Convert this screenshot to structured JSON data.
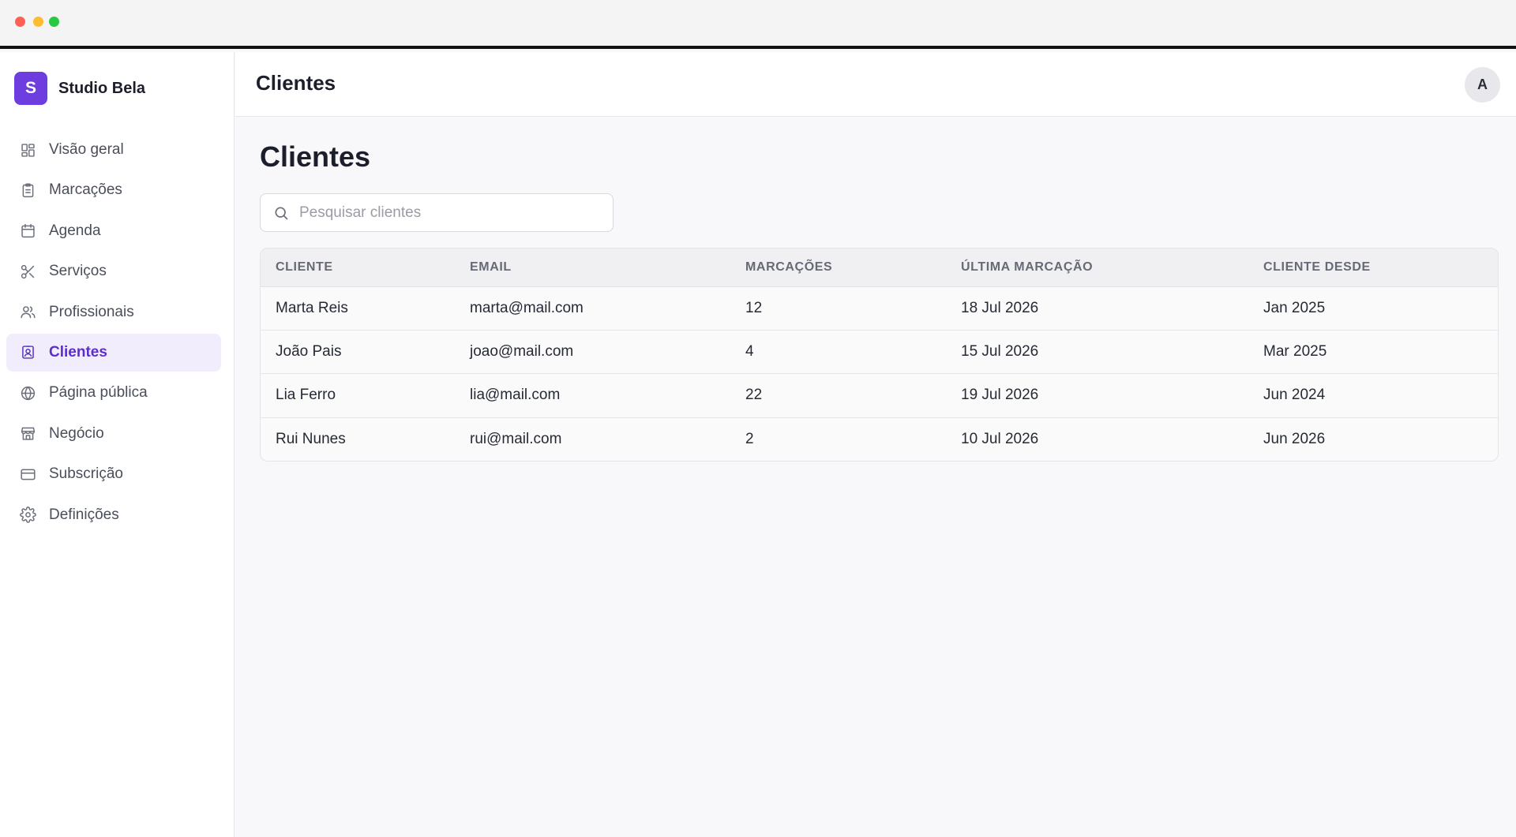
{
  "brand": {
    "logo_letter": "S",
    "name": "Studio Bela",
    "accent": "#6d3de0"
  },
  "sidebar": {
    "items": [
      {
        "label": "Visão geral",
        "icon": "grid-icon"
      },
      {
        "label": "Marcações",
        "icon": "clipboard-icon"
      },
      {
        "label": "Agenda",
        "icon": "calendar-icon"
      },
      {
        "label": "Serviços",
        "icon": "scissors-icon"
      },
      {
        "label": "Profissionais",
        "icon": "users-icon"
      },
      {
        "label": "Clientes",
        "icon": "contact-card-icon",
        "active": true
      },
      {
        "label": "Página pública",
        "icon": "globe-icon"
      },
      {
        "label": "Negócio",
        "icon": "store-icon"
      },
      {
        "label": "Subscrição",
        "icon": "credit-card-icon"
      },
      {
        "label": "Definições",
        "icon": "gear-icon"
      }
    ]
  },
  "header": {
    "title": "Clientes",
    "avatar_initial": "A"
  },
  "main": {
    "title": "Clientes",
    "search": {
      "placeholder": "Pesquisar clientes",
      "value": ""
    },
    "table": {
      "columns": [
        "CLIENTE",
        "EMAIL",
        "MARCAÇÕES",
        "ÚLTIMA MARCAÇÃO",
        "CLIENTE DESDE"
      ],
      "rows": [
        [
          "Marta Reis",
          "marta@mail.com",
          "12",
          "18 Jul 2026",
          "Jan 2025"
        ],
        [
          "João Pais",
          "joao@mail.com",
          "4",
          "15 Jul 2026",
          "Mar 2025"
        ],
        [
          "Lia Ferro",
          "lia@mail.com",
          "22",
          "19 Jul 2026",
          "Jun 2024"
        ],
        [
          "Rui Nunes",
          "rui@mail.com",
          "2",
          "10 Jul 2026",
          "Jun 2026"
        ]
      ]
    }
  }
}
